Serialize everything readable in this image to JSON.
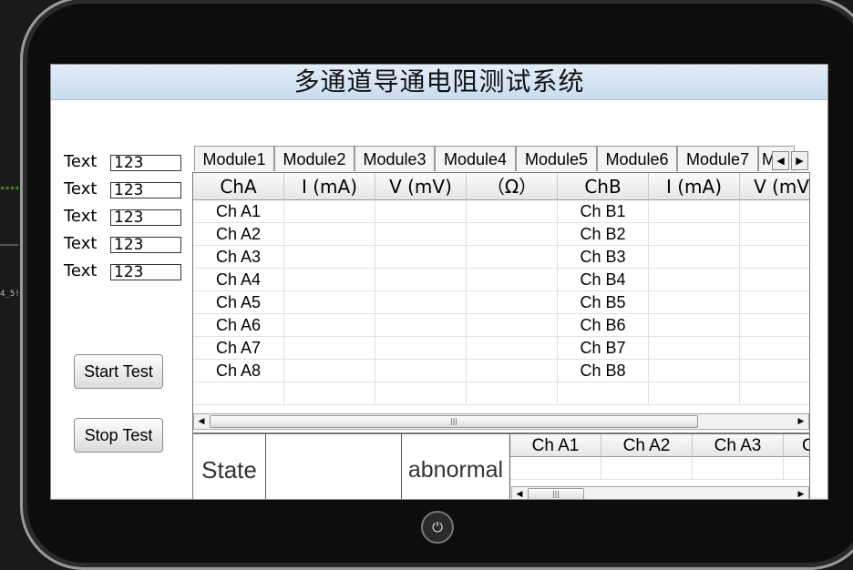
{
  "window": {
    "title": "多通道导通电阻测试系统"
  },
  "side_fields": [
    {
      "label": "Text",
      "value": "123"
    },
    {
      "label": "Text",
      "value": "123"
    },
    {
      "label": "Text",
      "value": "123"
    },
    {
      "label": "Text",
      "value": "123"
    },
    {
      "label": "Text",
      "value": "123"
    }
  ],
  "buttons": {
    "start": "Start Test",
    "stop": "Stop Test"
  },
  "module_tabs": [
    "Module1",
    "Module2",
    "Module3",
    "Module4",
    "Module5",
    "Module6",
    "Module7",
    "M"
  ],
  "grid": {
    "headers": [
      "ChA",
      "I (mA)",
      "V (mV)",
      "（Ω）",
      "ChB",
      "I (mA)",
      "V (mV)"
    ],
    "rows": [
      [
        "Ch A1",
        "",
        "",
        "",
        "Ch B1",
        "",
        ""
      ],
      [
        "Ch A2",
        "",
        "",
        "",
        "Ch B2",
        "",
        ""
      ],
      [
        "Ch A3",
        "",
        "",
        "",
        "Ch B3",
        "",
        ""
      ],
      [
        "Ch A4",
        "",
        "",
        "",
        "Ch B4",
        "",
        ""
      ],
      [
        "Ch A5",
        "",
        "",
        "",
        "Ch B5",
        "",
        ""
      ],
      [
        "Ch A6",
        "",
        "",
        "",
        "Ch B6",
        "",
        ""
      ],
      [
        "Ch A7",
        "",
        "",
        "",
        "Ch B7",
        "",
        ""
      ],
      [
        "Ch A8",
        "",
        "",
        "",
        "Ch B8",
        "",
        ""
      ],
      [
        "",
        "",
        "",
        "",
        "",
        "",
        ""
      ]
    ]
  },
  "status": {
    "state_label": "State",
    "state_value": "",
    "abnormal_label": "abnormal",
    "channel_headers": [
      "Ch A1",
      "Ch A2",
      "Ch A3",
      "C"
    ]
  },
  "background_text": {
    "dots": "****",
    "fragment": "4_5!"
  },
  "icons": {
    "power": "power-icon",
    "tab_left": "triangle-left-icon",
    "tab_right": "triangle-right-icon",
    "scroll_left": "triangle-left-icon",
    "scroll_right": "triangle-right-icon",
    "scroll_grip": "grip-icon"
  }
}
